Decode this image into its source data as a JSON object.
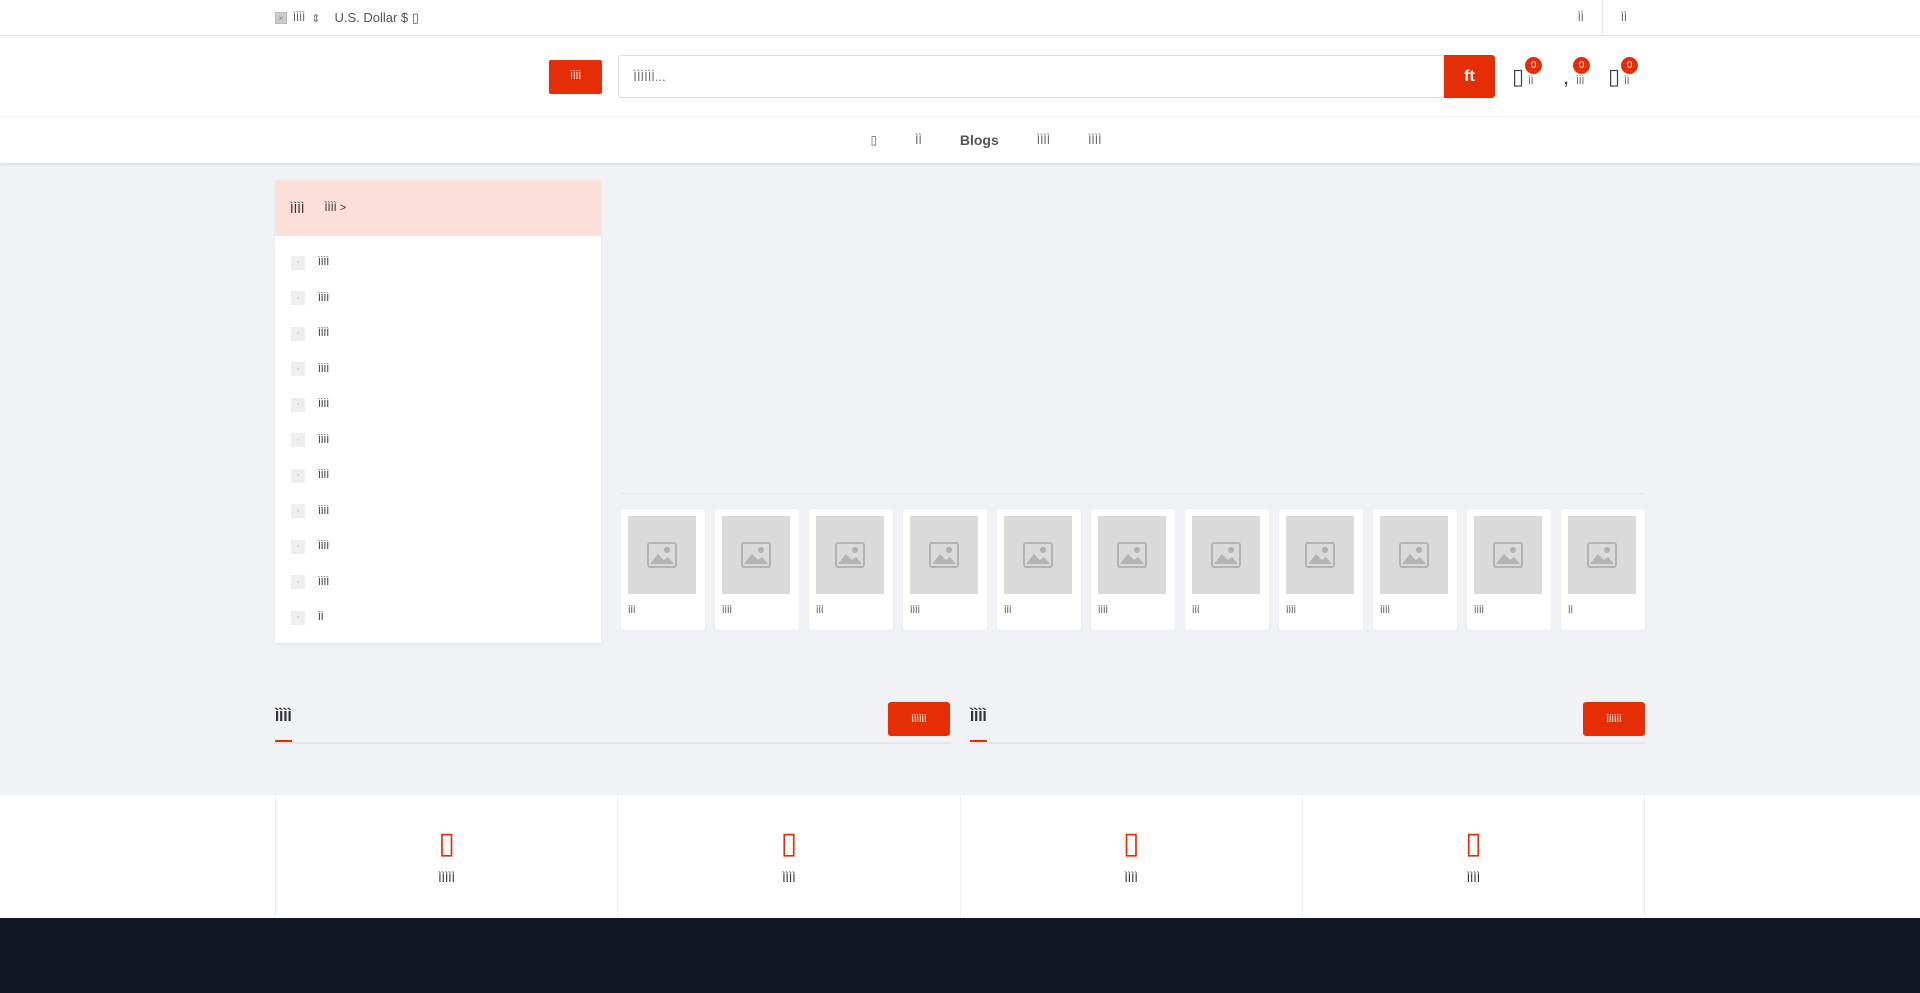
{
  "topbar": {
    "language": "ÌÌÌÌ",
    "currency": "U.S. Dollar $",
    "links": [
      "ÌÌ",
      "ÌÌ"
    ]
  },
  "header": {
    "category_button": "ÌÌÌÌ",
    "search_placeholder": "ÌÌÌÌÌÌ...",
    "search_button_glyph": "ft",
    "icons": [
      {
        "name": "compare",
        "label": "ÌÌ",
        "count": "0"
      },
      {
        "name": "wishlist",
        "label": "ÌÌÌ",
        "count": "0"
      },
      {
        "name": "cart",
        "label": "ÌÌ",
        "count": "0"
      }
    ]
  },
  "nav": {
    "items": [
      "",
      "ÌÌ",
      "Blogs",
      "ÌÌÌÌ",
      "ÌÌÌÌ"
    ]
  },
  "sidebar": {
    "title": "ÌÌÌÌ",
    "more": "ÌÌÌÌ >",
    "items": [
      "ÌÌÌÌ",
      "ÌÌÌÌ",
      "ÌÌÌÌ",
      "ÌÌÌÌ",
      "ÌÌÌÌ",
      "ÌÌÌÌ",
      "ÌÌÌÌ",
      "ÌÌÌÌ",
      "ÌÌÌÌ",
      "ÌÌÌÌ",
      "ÌÌ"
    ]
  },
  "categories": [
    "ÌÌÌ",
    "ÌÌÌÌ",
    "ÌÌÌ",
    "ÌÌÌÌ",
    "ÌÌÌ",
    "ÌÌÌÌ",
    "ÌÌÌ",
    "ÌÌÌÌ",
    "ÌÌÌÌ",
    "ÌÌÌÌ",
    "ÌÌ"
  ],
  "sections": [
    {
      "title": "ÌÌÌÌ",
      "button": "ÌÌÌÌÌÌ"
    },
    {
      "title": "ÌÌÌÌ",
      "button": "ÌÌÌÌÌÌ"
    }
  ],
  "features": [
    "ÌÌÌÌÌ",
    "ÌÌÌÌ",
    "ÌÌÌÌ",
    "ÌÌÌÌ"
  ],
  "colors": {
    "accent": "#e52e06",
    "footer": "#121625",
    "background": "#f0f2f5"
  }
}
